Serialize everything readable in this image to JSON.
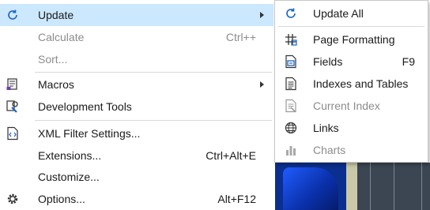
{
  "menu": {
    "items": [
      {
        "label": "Update",
        "shortcut": "",
        "icon": "refresh-icon"
      },
      {
        "label": "Calculate",
        "shortcut": "Ctrl++"
      },
      {
        "label": "Sort..."
      },
      {
        "label": "Macros",
        "icon": "macros-icon"
      },
      {
        "label": "Development Tools",
        "icon": "development-tools-icon"
      },
      {
        "label": "XML Filter Settings...",
        "icon": "xml-filter-icon"
      },
      {
        "label": "Extensions...",
        "shortcut": "Ctrl+Alt+E"
      },
      {
        "label": "Customize..."
      },
      {
        "label": "Options...",
        "shortcut": "Alt+F12",
        "icon": "gear-icon"
      }
    ]
  },
  "submenu": {
    "items": [
      {
        "label": "Update All",
        "icon": "refresh-icon"
      },
      {
        "label": "Page Formatting",
        "icon": "page-formatting-icon"
      },
      {
        "label": "Fields",
        "shortcut": "F9",
        "icon": "fields-icon"
      },
      {
        "label": "Indexes and Tables",
        "icon": "indexes-icon"
      },
      {
        "label": "Current Index",
        "icon": "current-index-icon"
      },
      {
        "label": "Links",
        "icon": "links-icon"
      },
      {
        "label": "Charts",
        "icon": "charts-icon"
      }
    ]
  },
  "colors": {
    "highlight": "#cce8ff",
    "accent": "#1a63c6",
    "disabled_text": "#8c8c8c"
  }
}
